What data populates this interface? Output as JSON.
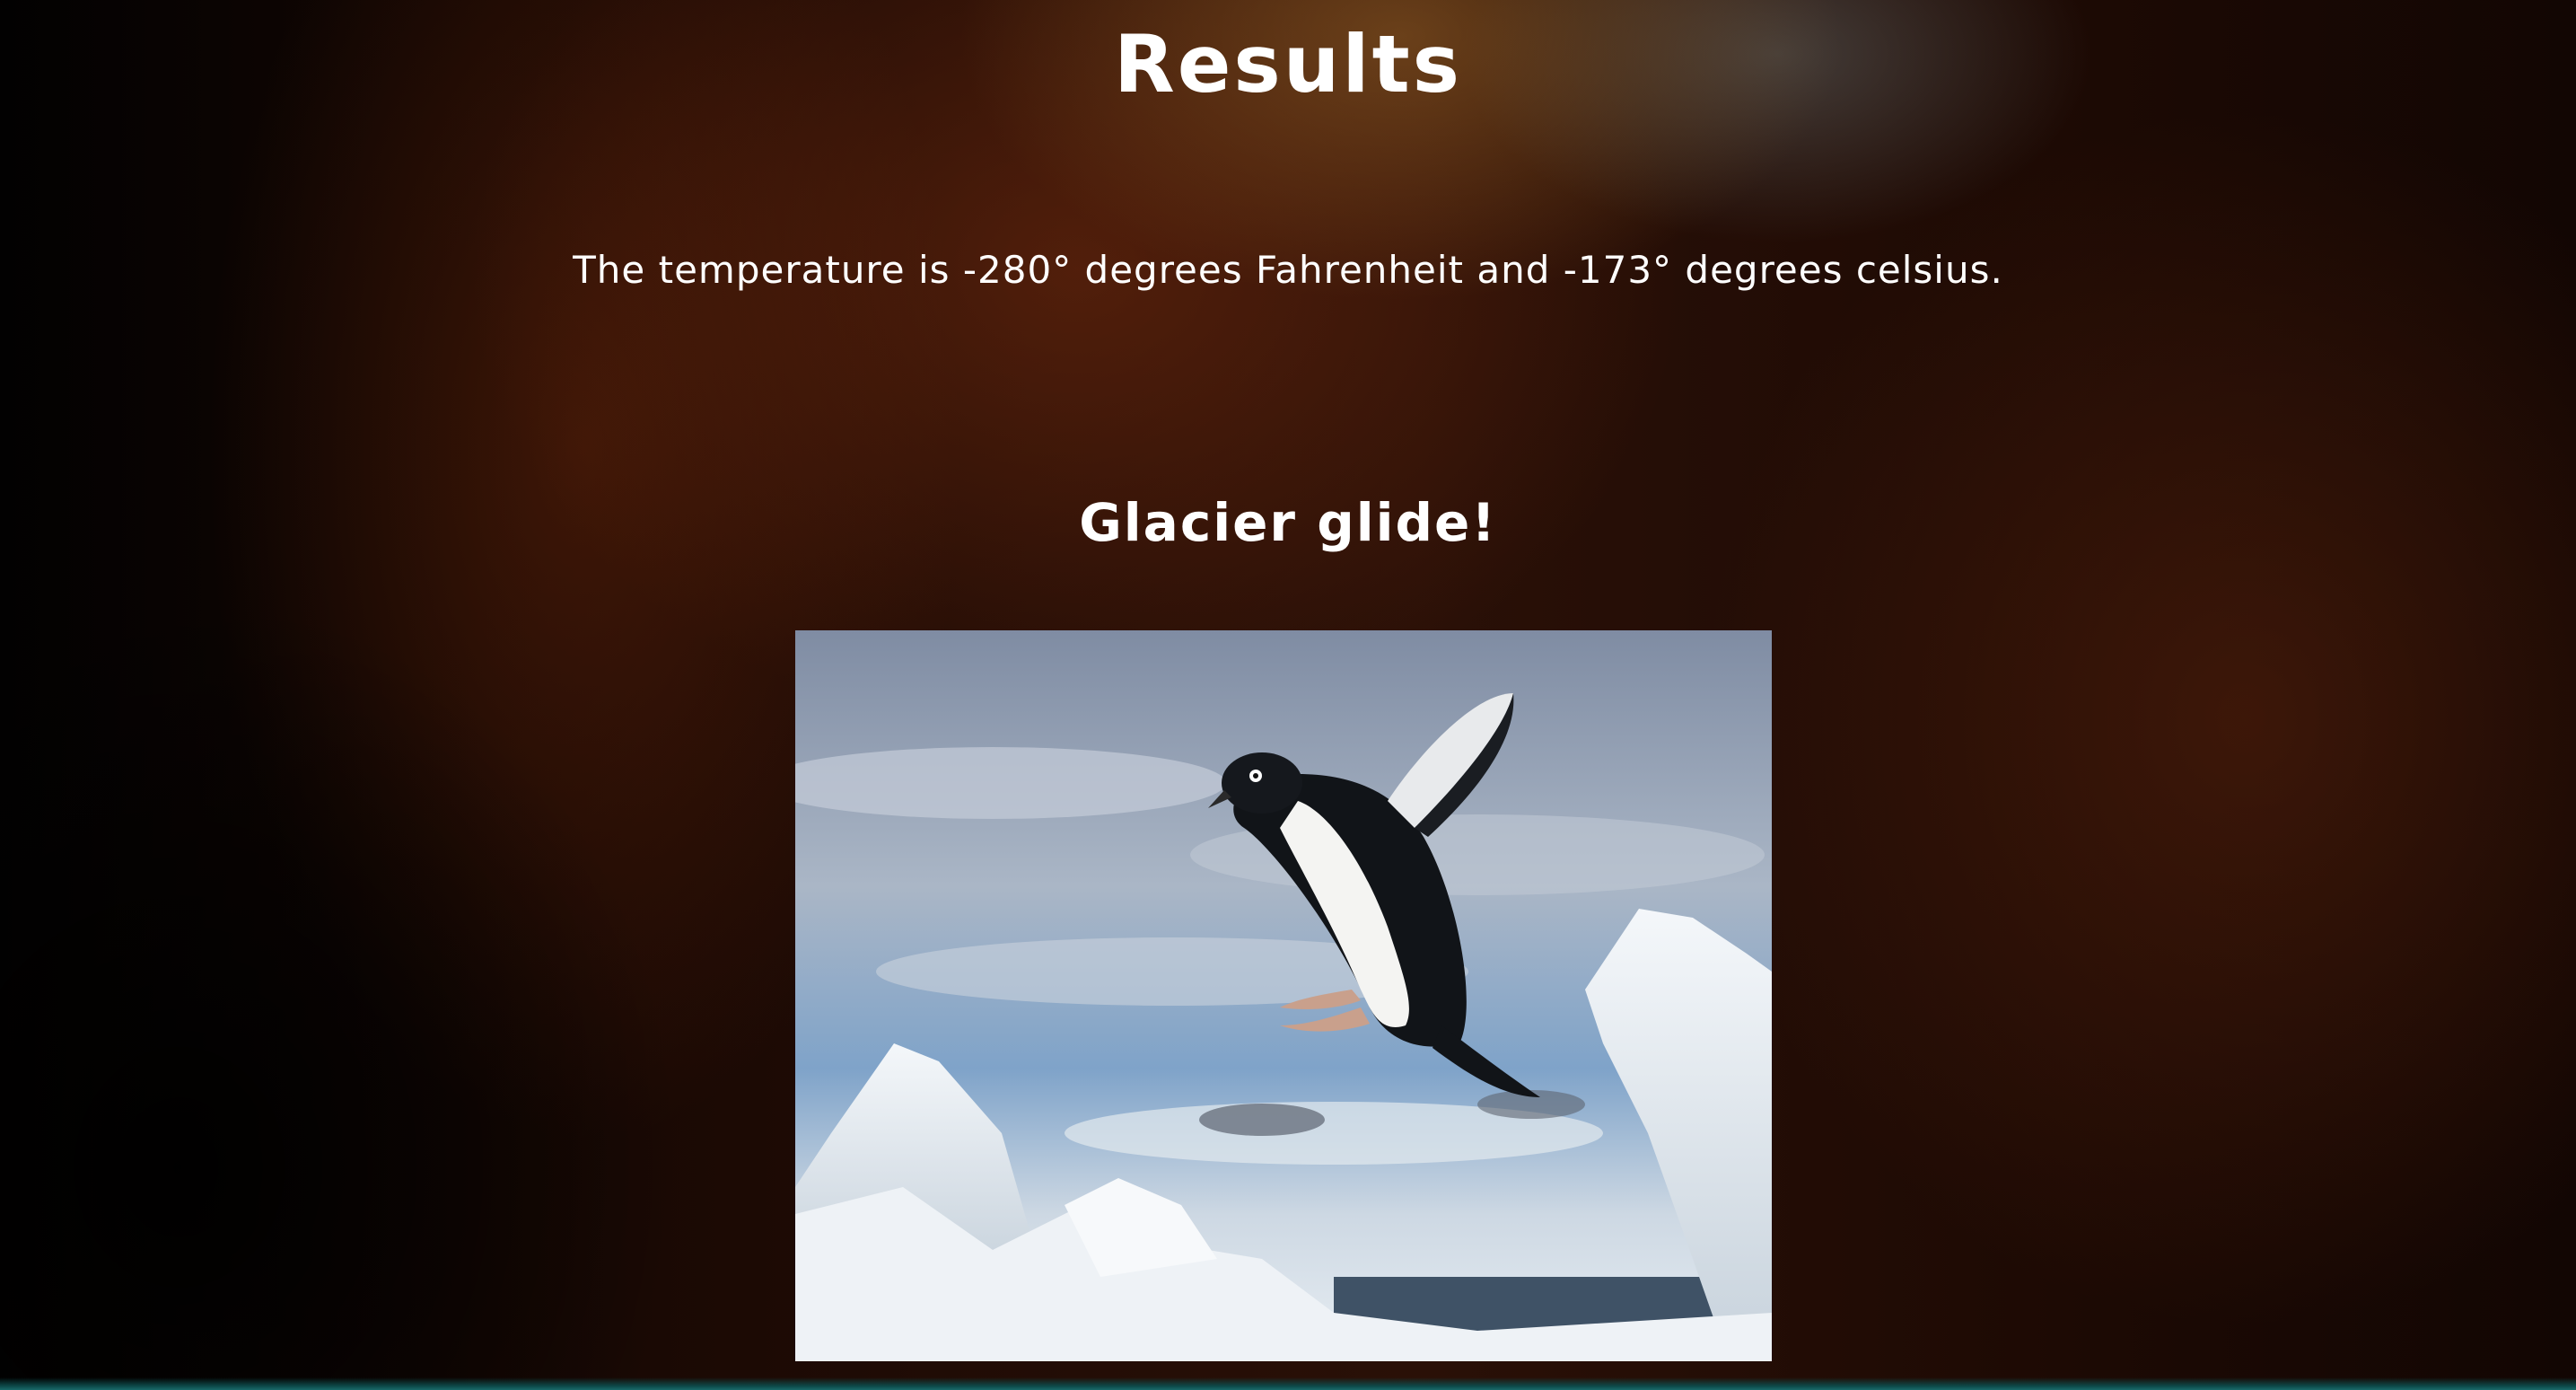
{
  "page": {
    "title": "Results",
    "result_text": "The temperature is -280° degrees Fahrenheit and -173° degrees celsius.",
    "subtitle": "Glacier glide!"
  },
  "photo": {
    "subject": "penguin jumping between ice floes"
  },
  "colors": {
    "text": "#ffffff",
    "background_dark": "#050302",
    "background_glow": "#2a1007"
  }
}
